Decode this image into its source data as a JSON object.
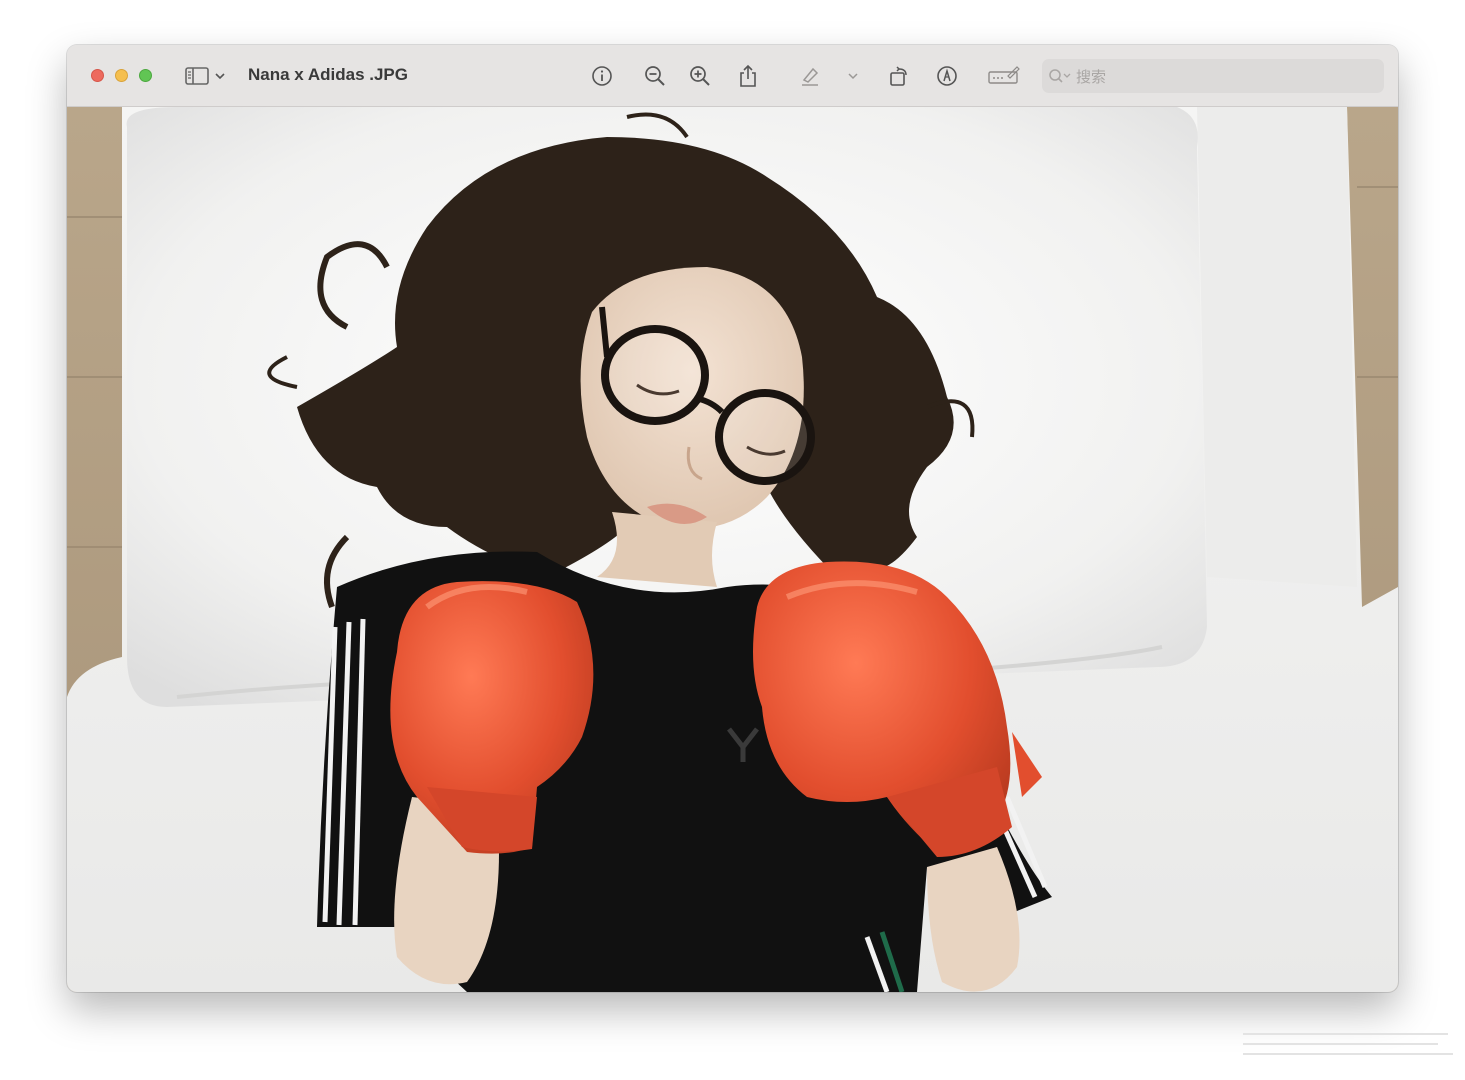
{
  "window": {
    "title": "Nana x Adidas .JPG",
    "search_placeholder": "搜索"
  },
  "toolbar": {
    "icons": [
      "sidebar-icon",
      "chevron-down-icon",
      "info-icon",
      "zoom-out-icon",
      "zoom-in-icon",
      "share-icon",
      "highlight-pen-icon",
      "chevron-down-icon",
      "rotate-icon",
      "markup-icon",
      "signature-icon",
      "search-icon"
    ]
  },
  "colors": {
    "close": "#ed6a5e",
    "minimize": "#f5bf4f",
    "maximize": "#61c554",
    "glove": "#e24e2e"
  }
}
